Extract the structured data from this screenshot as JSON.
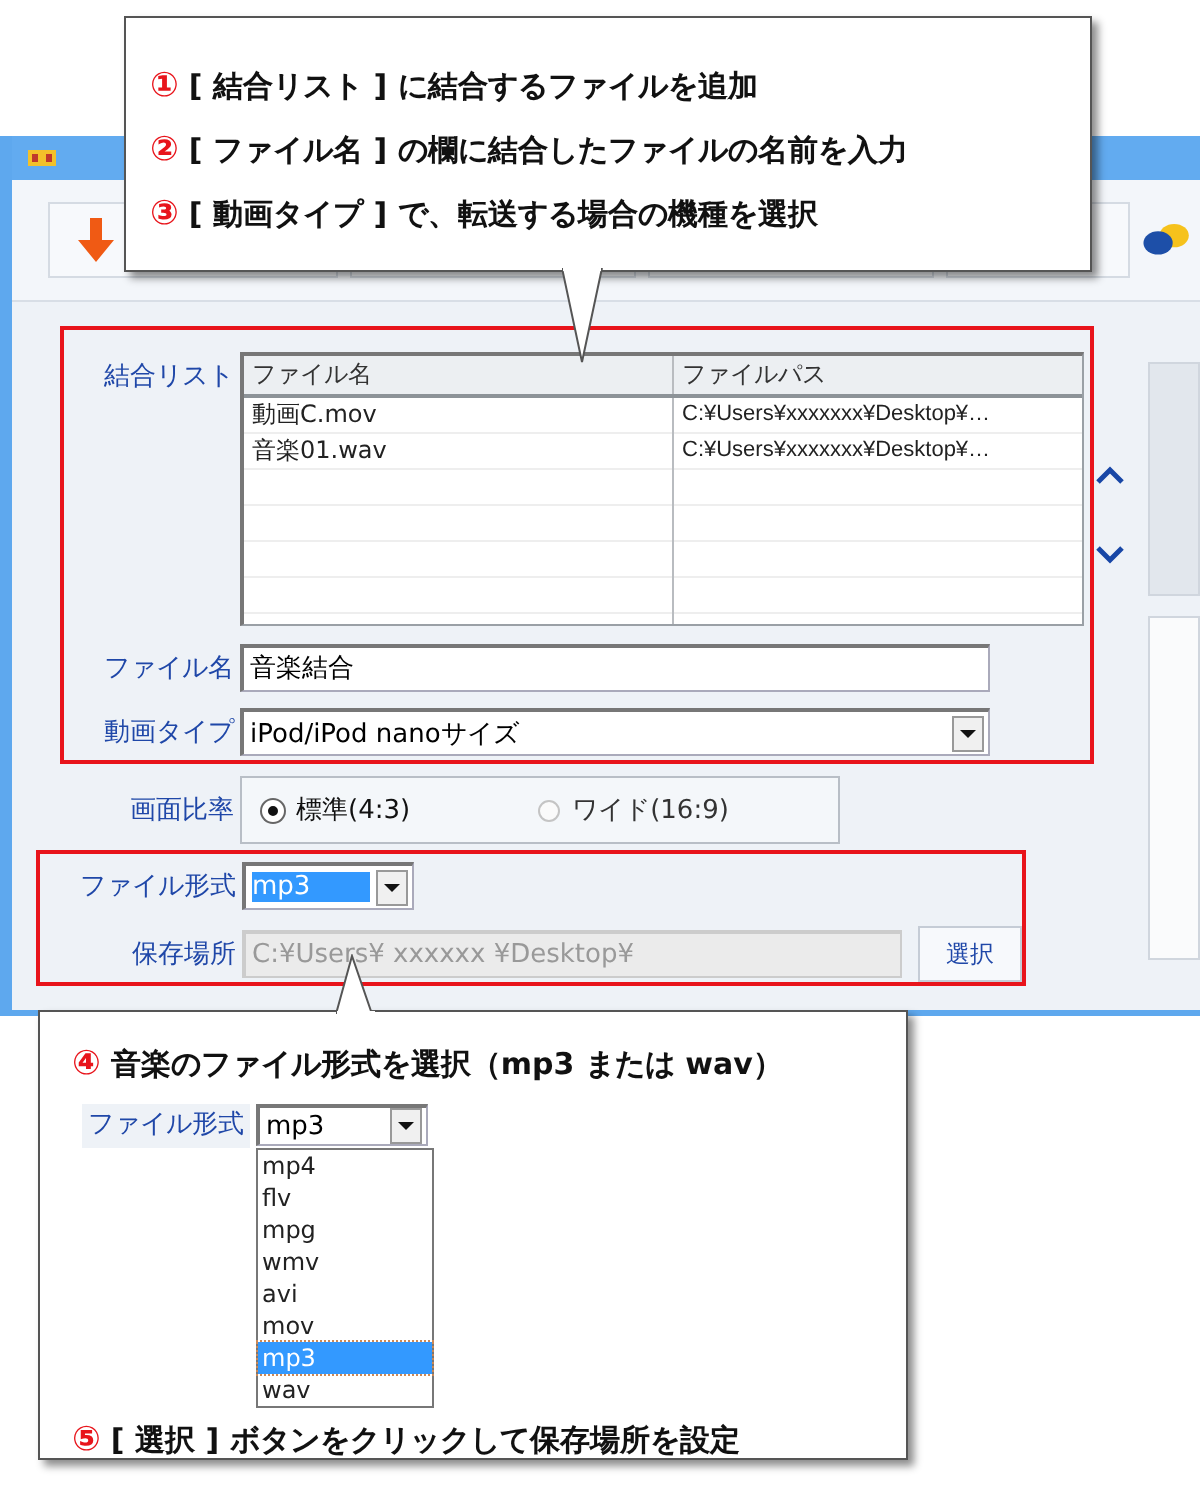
{
  "callout_top": {
    "steps": [
      {
        "number": "①",
        "text": "[ 結合リスト ] に結合するファイルを追加"
      },
      {
        "number": "②",
        "text": "[ ファイル名 ] の欄に結合したファイルの名前を入力"
      },
      {
        "number": "③",
        "text": "[ 動画タイプ ] で、転送する場合の機種を選択"
      }
    ]
  },
  "merge_list": {
    "label": "結合リスト",
    "columns": [
      "ファイル名",
      "ファイルパス"
    ],
    "rows": [
      [
        "動画C.mov",
        "C:¥Users¥xxxxxxx¥Desktop¥…"
      ],
      [
        "音楽01.wav",
        "C:¥Users¥xxxxxxx¥Desktop¥…"
      ]
    ]
  },
  "file_name": {
    "label": "ファイル名",
    "value": "音楽結合"
  },
  "video_type": {
    "label": "動画タイプ",
    "value": "iPod/iPod nanoサイズ"
  },
  "aspect_ratio": {
    "label": "画面比率",
    "options": [
      {
        "label": "標準(4:3)",
        "selected": true
      },
      {
        "label": "ワイド(16:9)",
        "selected": false
      }
    ]
  },
  "file_format": {
    "label": "ファイル形式",
    "value": "mp3",
    "highlighted": true
  },
  "save_location": {
    "label": "保存場所",
    "value": "C:¥Users¥ xxxxxx ¥Desktop¥",
    "disabled": true,
    "button": "選択"
  },
  "callout_bottom": {
    "step_format": {
      "number": "④",
      "text": "音楽のファイル形式を選択（mp3 または wav）"
    },
    "dropdown": {
      "label": "ファイル形式",
      "value": "mp3",
      "options": [
        {
          "label": "mp4",
          "selected": false
        },
        {
          "label": "flv",
          "selected": false
        },
        {
          "label": "mpg",
          "selected": false
        },
        {
          "label": "wmv",
          "selected": false
        },
        {
          "label": "avi",
          "selected": false
        },
        {
          "label": "mov",
          "selected": false
        },
        {
          "label": "mp3",
          "selected": true
        },
        {
          "label": "wav",
          "selected": false
        }
      ]
    },
    "step_location": {
      "number": "⑤",
      "text": "[ 選択 ] ボタンをクリックして保存場所を設定"
    }
  }
}
